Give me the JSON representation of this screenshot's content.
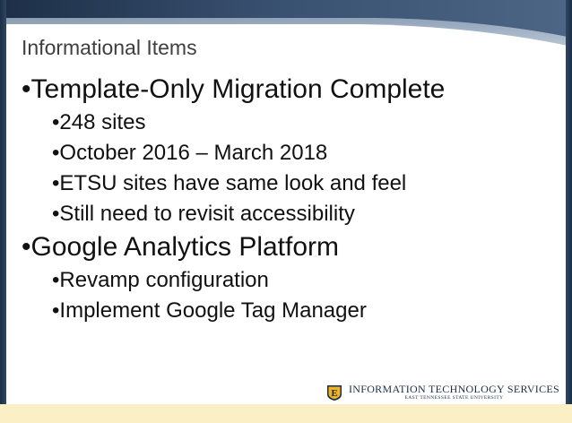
{
  "slide": {
    "title": "Informational Items",
    "bullets": [
      {
        "text": "Template-Only Migration Complete",
        "children": [
          "248 sites",
          "October 2016 – March 2018",
          "ETSU sites have same look and feel",
          "Still need to revisit accessibility"
        ]
      },
      {
        "text": "Google Analytics Platform",
        "children": [
          "Revamp configuration",
          "Implement Google Tag Manager"
        ]
      }
    ],
    "bullet_glyph": "•"
  },
  "logo": {
    "badge_letter": "E",
    "main": "INFORMATION TECHNOLOGY SERVICES",
    "sub": "EAST TENNESSEE STATE UNIVERSITY"
  },
  "colors": {
    "navy": "#1c2e45",
    "band_light": "#fbefc5",
    "gold": "#f0b323"
  }
}
